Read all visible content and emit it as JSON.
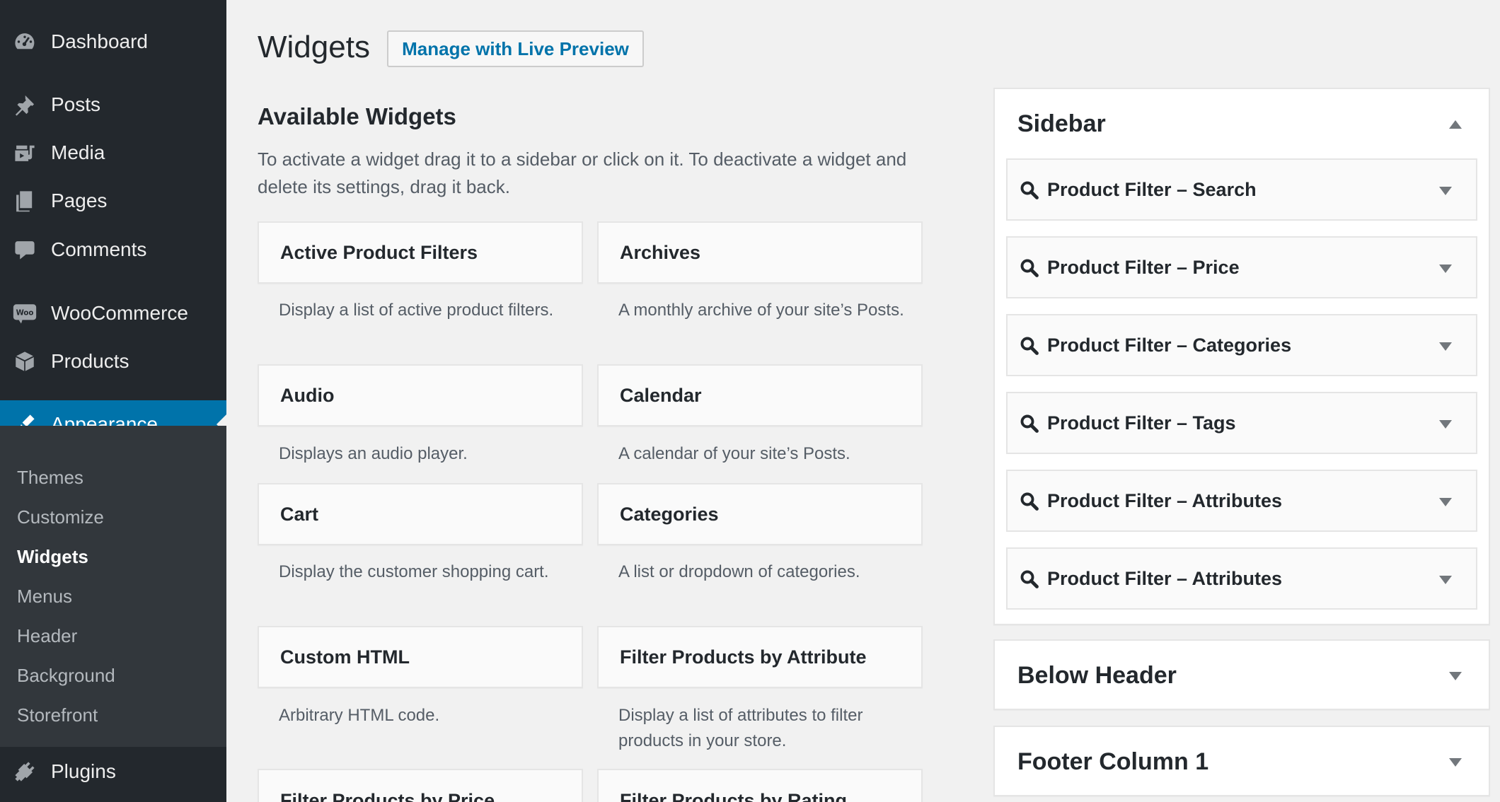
{
  "admin_menu": {
    "items": [
      {
        "label": "Dashboard",
        "icon": "dashboard-icon"
      },
      {
        "label": "Posts",
        "icon": "pin-icon"
      },
      {
        "label": "Media",
        "icon": "media-icon"
      },
      {
        "label": "Pages",
        "icon": "pages-icon"
      },
      {
        "label": "Comments",
        "icon": "comment-icon"
      },
      {
        "label": "WooCommerce",
        "icon": "woo-icon",
        "icon_text": "Woo"
      },
      {
        "label": "Products",
        "icon": "box-icon"
      },
      {
        "label": "Appearance",
        "icon": "brush-icon",
        "current": true
      },
      {
        "label": "Plugins",
        "icon": "plug-icon"
      }
    ],
    "submenu": [
      {
        "label": "Themes"
      },
      {
        "label": "Customize"
      },
      {
        "label": "Widgets",
        "current": true
      },
      {
        "label": "Menus"
      },
      {
        "label": "Header"
      },
      {
        "label": "Background"
      },
      {
        "label": "Storefront"
      }
    ]
  },
  "header": {
    "title": "Widgets",
    "live_preview_label": "Manage with Live Preview"
  },
  "available": {
    "title": "Available Widgets",
    "description": "To activate a widget drag it to a sidebar or click on it. To deactivate a widget and delete its settings, drag it back.",
    "widgets": [
      {
        "title": "Active Product Filters",
        "desc": "Display a list of active product filters."
      },
      {
        "title": "Archives",
        "desc": "A monthly archive of your site’s Posts."
      },
      {
        "title": "Audio",
        "desc": "Displays an audio player."
      },
      {
        "title": "Calendar",
        "desc": "A calendar of your site’s Posts."
      },
      {
        "title": "Cart",
        "desc": "Display the customer shopping cart."
      },
      {
        "title": "Categories",
        "desc": "A list or dropdown of categories."
      },
      {
        "title": "Custom HTML",
        "desc": "Arbitrary HTML code."
      },
      {
        "title": "Filter Products by Attribute",
        "desc": "Display a list of attributes to filter products in your store."
      },
      {
        "title": "Filter Products by Price",
        "desc": ""
      },
      {
        "title": "Filter Products by Rating",
        "desc": ""
      }
    ]
  },
  "sidebars": [
    {
      "name": "Sidebar",
      "expanded": true,
      "widgets": [
        {
          "title": "Product Filter – Search",
          "icon": "search-icon"
        },
        {
          "title": "Product Filter – Price",
          "icon": "search-icon"
        },
        {
          "title": "Product Filter – Categories",
          "icon": "search-icon"
        },
        {
          "title": "Product Filter – Tags",
          "icon": "search-icon"
        },
        {
          "title": "Product Filter – Attributes",
          "icon": "search-icon"
        },
        {
          "title": "Product Filter – Attributes",
          "icon": "search-icon"
        }
      ]
    },
    {
      "name": "Below Header",
      "expanded": false
    },
    {
      "name": "Footer Column 1",
      "expanded": false
    }
  ],
  "colors": {
    "menu_bg": "#23282d",
    "submenu_bg": "#32373c",
    "accent": "#0073aa",
    "page_bg": "#f1f1f1"
  }
}
